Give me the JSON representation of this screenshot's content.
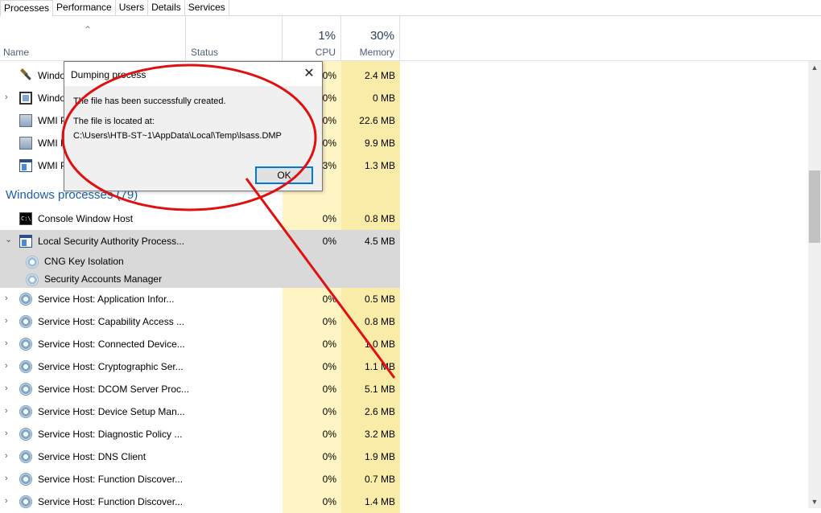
{
  "tabs": [
    "Processes",
    "Performance",
    "Users",
    "Details",
    "Services"
  ],
  "header": {
    "name": "Name",
    "status": "Status",
    "cpu_pct": "1%",
    "cpu_label": "CPU",
    "mem_pct": "30%",
    "mem_label": "Memory"
  },
  "top_rows": [
    {
      "name": "Windo",
      "icon": "tool-icon",
      "cpu": "0%",
      "mem": "2.4 MB",
      "expandable": false
    },
    {
      "name": "Windo",
      "icon": "monitor-icon",
      "cpu": "0%",
      "mem": "0 MB",
      "expandable": true
    },
    {
      "name": "WMI P",
      "icon": "wmi-icon",
      "cpu": "0%",
      "mem": "22.6 MB",
      "expandable": false
    },
    {
      "name": "WMI P",
      "icon": "wmi-icon",
      "cpu": "0%",
      "mem": "9.9 MB",
      "expandable": false
    },
    {
      "name": "WMI P",
      "icon": "window-icon",
      "cpu": "3%",
      "mem": "1.3 MB",
      "expandable": false
    }
  ],
  "group": {
    "title": "Windows processes",
    "count": "(79)"
  },
  "windows_rows": [
    {
      "name": "Console Window Host",
      "icon": "console-icon",
      "cpu": "0%",
      "mem": "0.8 MB",
      "expandable": false
    },
    {
      "name": "Local Security Authority Process...",
      "icon": "window-icon",
      "cpu": "0%",
      "mem": "4.5 MB",
      "expandable": true,
      "expanded": true,
      "selected": true
    }
  ],
  "lsa_children": [
    {
      "name": "CNG Key Isolation",
      "icon": "gear-icon"
    },
    {
      "name": "Security Accounts Manager",
      "icon": "gear-icon"
    }
  ],
  "service_rows": [
    {
      "name": "Service Host: Application Infor...",
      "cpu": "0%",
      "mem": "0.5 MB"
    },
    {
      "name": "Service Host: Capability Access ...",
      "cpu": "0%",
      "mem": "0.8 MB"
    },
    {
      "name": "Service Host: Connected Device...",
      "cpu": "0%",
      "mem": "1.0 MB"
    },
    {
      "name": "Service Host: Cryptographic Ser...",
      "cpu": "0%",
      "mem": "1.1 MB"
    },
    {
      "name": "Service Host: DCOM Server Proc...",
      "cpu": "0%",
      "mem": "5.1 MB"
    },
    {
      "name": "Service Host: Device Setup Man...",
      "cpu": "0%",
      "mem": "2.6 MB"
    },
    {
      "name": "Service Host: Diagnostic Policy ...",
      "cpu": "0%",
      "mem": "3.2 MB"
    },
    {
      "name": "Service Host: DNS Client",
      "cpu": "0%",
      "mem": "1.9 MB"
    },
    {
      "name": "Service Host: Function Discover...",
      "cpu": "0%",
      "mem": "0.7 MB"
    },
    {
      "name": "Service Host: Function Discover...",
      "cpu": "0%",
      "mem": "1.4 MB"
    }
  ],
  "dialog": {
    "title": "Dumping process",
    "message1": "The file has been successfully created.",
    "message2": "The file is located at:",
    "path": "C:\\Users\\HTB-ST~1\\AppData\\Local\\Temp\\lsass.DMP",
    "ok_label": "OK"
  },
  "colors": {
    "annotation": "#e01010",
    "group_title": "#1e5fa8",
    "cpu_column": "#fff4c4",
    "mem_column": "#f9eca8",
    "selected_row": "#d9d9d9"
  }
}
